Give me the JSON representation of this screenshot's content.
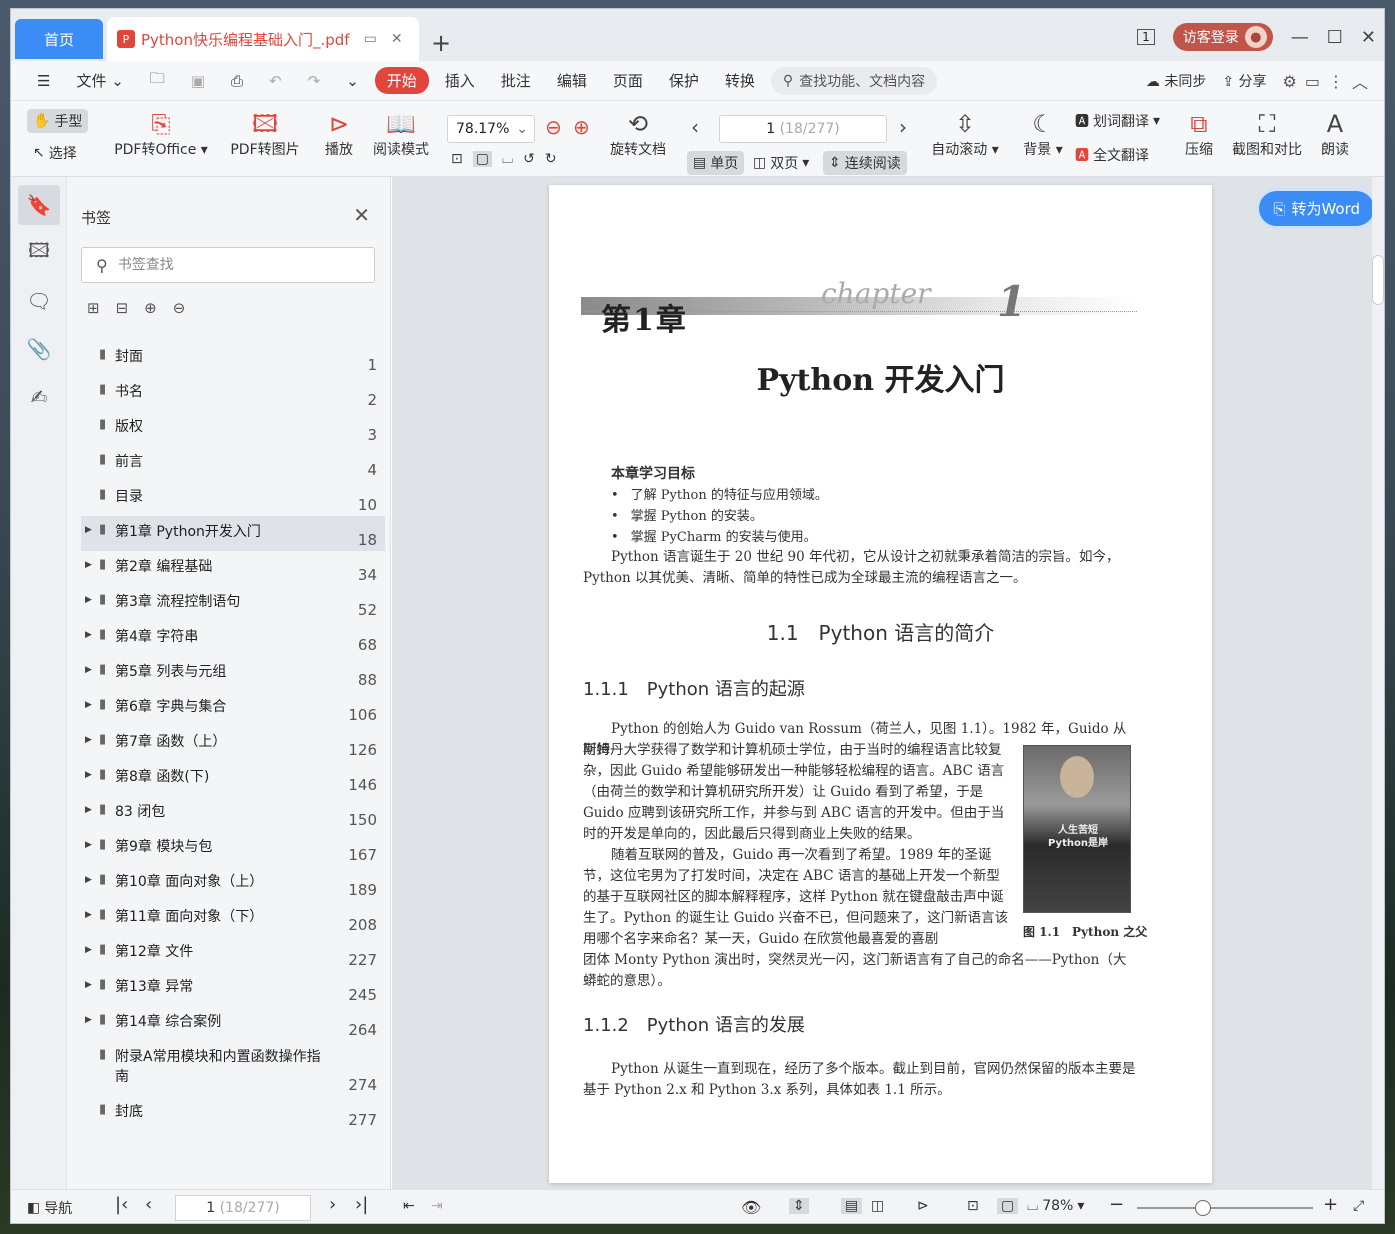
{
  "titlebar": {
    "home_tab": "首页",
    "doc_tab": "Python快乐编程基础入门_.pdf",
    "add_tab": "+",
    "page_indicator": "1",
    "login_label": "访客登录"
  },
  "menubar": {
    "file": "文件",
    "items": [
      "开始",
      "插入",
      "批注",
      "编辑",
      "页面",
      "保护",
      "转换"
    ],
    "search": "查找功能、文档内容",
    "sync": "未同步",
    "share": "分享"
  },
  "ribbon": {
    "hand": "手型",
    "select": "选择",
    "pdf_to_office": "PDF转Office",
    "pdf_to_image": "PDF转图片",
    "play": "播放",
    "read_mode": "阅读模式",
    "zoom": "78.17%",
    "rotate": "旋转文档",
    "page_current": "1",
    "page_total": "(18/277)",
    "single": "单页",
    "double": "双页",
    "continuous": "连续阅读",
    "auto_scroll": "自动滚动",
    "background": "背景",
    "word_translate": "划词翻译",
    "full_translate": "全文翻译",
    "compress": "压缩",
    "screenshot_compare": "截图和对比",
    "read_aloud": "朗读"
  },
  "bookmarks": {
    "title": "书签",
    "search_placeholder": "书签查找",
    "items": [
      {
        "label": "封面",
        "page": "1",
        "expandable": false
      },
      {
        "label": "书名",
        "page": "2",
        "expandable": false
      },
      {
        "label": "版权",
        "page": "3",
        "expandable": false
      },
      {
        "label": "前言",
        "page": "4",
        "expandable": false
      },
      {
        "label": "目录",
        "page": "10",
        "expandable": false
      },
      {
        "label": "第1章 Python开发入门",
        "page": "18",
        "expandable": true,
        "selected": true
      },
      {
        "label": "第2章 编程基础",
        "page": "34",
        "expandable": true
      },
      {
        "label": "第3章 流程控制语句",
        "page": "52",
        "expandable": true
      },
      {
        "label": "第4章 字符串",
        "page": "68",
        "expandable": true
      },
      {
        "label": "第5章 列表与元组",
        "page": "88",
        "expandable": true
      },
      {
        "label": "第6章 字典与集合",
        "page": "106",
        "expandable": true
      },
      {
        "label": "第7章 函数（上）",
        "page": "126",
        "expandable": true
      },
      {
        "label": "第8章 函数(下)",
        "page": "146",
        "expandable": true
      },
      {
        "label": "83 闭包",
        "page": "150",
        "expandable": true
      },
      {
        "label": "第9章 模块与包",
        "page": "167",
        "expandable": true
      },
      {
        "label": "第10章 面向对象（上）",
        "page": "189",
        "expandable": true
      },
      {
        "label": "第11章 面向对象（下）",
        "page": "208",
        "expandable": true
      },
      {
        "label": "第12章 文件",
        "page": "227",
        "expandable": true
      },
      {
        "label": "第13章 异常",
        "page": "245",
        "expandable": true
      },
      {
        "label": "第14章 综合案例",
        "page": "264",
        "expandable": true
      },
      {
        "label": "附录A常用模块和内置函数操作指南",
        "page": "274",
        "expandable": false,
        "tall": true
      },
      {
        "label": "封底",
        "page": "277",
        "expandable": false
      }
    ]
  },
  "document": {
    "to_word": "转为Word",
    "chapter_num": "第1章",
    "chapter_en": "chapter",
    "chapter_en_num": "1",
    "chapter_title": "Python 开发入门",
    "goals_heading": "本章学习目标",
    "goals": [
      "了解 Python 的特征与应用领域。",
      "掌握 Python 的安装。",
      "掌握 PyCharm 的安装与使用。"
    ],
    "intro": "Python 语言诞生于 20 世纪 90 年代初，它从设计之初就秉承着简洁的宗旨。如今，Python 以其优美、清晰、简单的特性已成为全球最主流的编程语言之一。",
    "sec_1_1": "1.1　Python 语言的简介",
    "sec_1_1_1": "1.1.1　Python 语言的起源",
    "p1_line1": "Python 的创始人为 Guido van Rossum（荷兰人，见图 1.1）。1982 年，Guido 从阿姆",
    "p1_rest": "斯特丹大学获得了数学和计算机硕士学位，由于当时的编程语言比较复杂，因此 Guido 希望能够研发出一种能够轻松编程的语言。ABC 语言（由荷兰的数学和计算机研究所开发）让 Guido 看到了希望，于是 Guido 应聘到该研究所工作，并参与到 ABC 语言的开发中。但由于当时的开发是单向的，因此最后只得到商业上失败的结果。",
    "p2_part": "随着互联网的普及，Guido 再一次看到了希望。1989 年的圣诞节，这位宅男为了打发时间，决定在 ABC 语言的基础上开发一个新型的基于互联网社区的脚本解释程序，这样 Python 就在键盘敲击声中诞生了。Python 的诞生让 Guido 兴奋不已，但问题来了，这门新语言该用哪个名字来命名？某一天，Guido 在欣赏他最喜爱的喜剧",
    "p2_tail": "团体 Monty Python 演出时，突然灵光一闪，这门新语言有了自己的命名——Python（大蟒蛇的意思）。",
    "photo_shirt": "人生苦短 Python是岸",
    "figure_caption": "图 1.1　Python 之父",
    "sec_1_1_2": "1.1.2　Python 语言的发展",
    "p3": "Python 从诞生一直到现在，经历了多个版本。截止到目前，官网仍然保留的版本主要是基于 Python 2.x 和 Python 3.x 系列，具体如表 1.1 所示。"
  },
  "statusbar": {
    "nav": "导航",
    "page_current": "1",
    "page_total": "(18/277)",
    "zoom": "78%"
  },
  "colors": {
    "accent_blue": "#3b8cf4",
    "accent_red": "#e0463c"
  }
}
